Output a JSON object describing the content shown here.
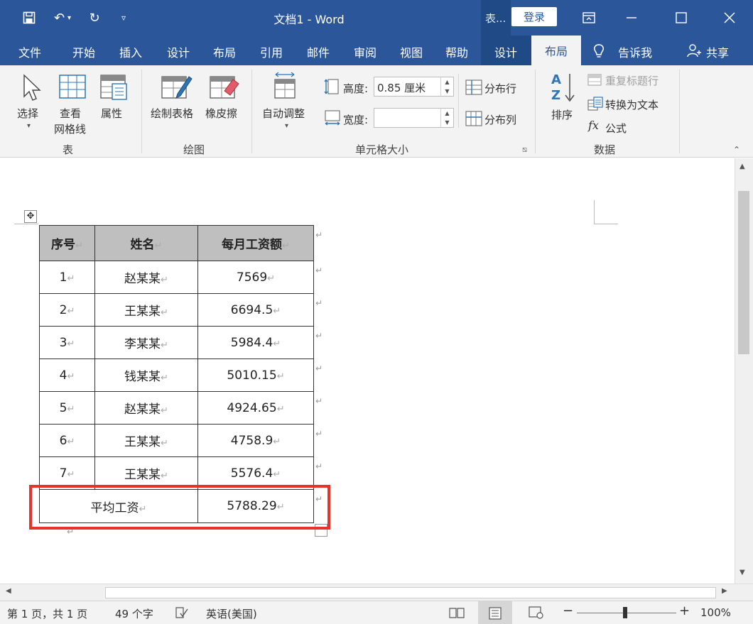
{
  "title_bar": {
    "document_title": "文档1  -  Word",
    "context_tab_label": "表...",
    "login_label": "登录"
  },
  "menu": {
    "items": [
      "文件",
      "开始",
      "插入",
      "设计",
      "布局",
      "引用",
      "邮件",
      "审阅",
      "视图",
      "帮助",
      "设计"
    ],
    "active": "布局",
    "tell_me": "告诉我",
    "share": "共享"
  },
  "ribbon": {
    "table_group": {
      "select": "选择",
      "view_gridlines_1": "查看",
      "view_gridlines_2": "网格线",
      "properties": "属性",
      "group_label": "表"
    },
    "draw_group": {
      "draw_table": "绘制表格",
      "eraser": "橡皮擦",
      "group_label": "绘图"
    },
    "cell_size_group": {
      "autofit": "自动调整",
      "height_label": "高度:",
      "height_value": "0.85 厘米",
      "width_label": "宽度:",
      "width_value": "",
      "distribute_rows": "分布行",
      "distribute_cols": "分布列",
      "group_label": "单元格大小"
    },
    "data_group": {
      "sort": "排序",
      "repeat_header": "重复标题行",
      "convert_to_text": "转换为文本",
      "formula": "公式",
      "group_label": "数据"
    }
  },
  "table": {
    "headers": [
      "序号",
      "姓名",
      "每月工资额"
    ],
    "rows": [
      {
        "no": "1",
        "name": "赵某某",
        "salary": "7569"
      },
      {
        "no": "2",
        "name": "王某某",
        "salary": "6694.5"
      },
      {
        "no": "3",
        "name": "李某某",
        "salary": "5984.4"
      },
      {
        "no": "4",
        "name": "钱某某",
        "salary": "5010.15"
      },
      {
        "no": "5",
        "name": "赵某某",
        "salary": "4924.65"
      },
      {
        "no": "6",
        "name": "王某某",
        "salary": "4758.9"
      },
      {
        "no": "7",
        "name": "王某某",
        "salary": "5576.4"
      }
    ],
    "average_label": "平均工资",
    "average_value": "5788.29",
    "paragraph_mark": "↵"
  },
  "status_bar": {
    "page_info": "第 1 页，共 1 页",
    "word_count": "49 个字",
    "language": "英语(美国)",
    "zoom": "100%"
  },
  "colors": {
    "title_bar": "#2b579a",
    "highlight_box": "#e8322c",
    "header_row": "#bfbfbf"
  }
}
